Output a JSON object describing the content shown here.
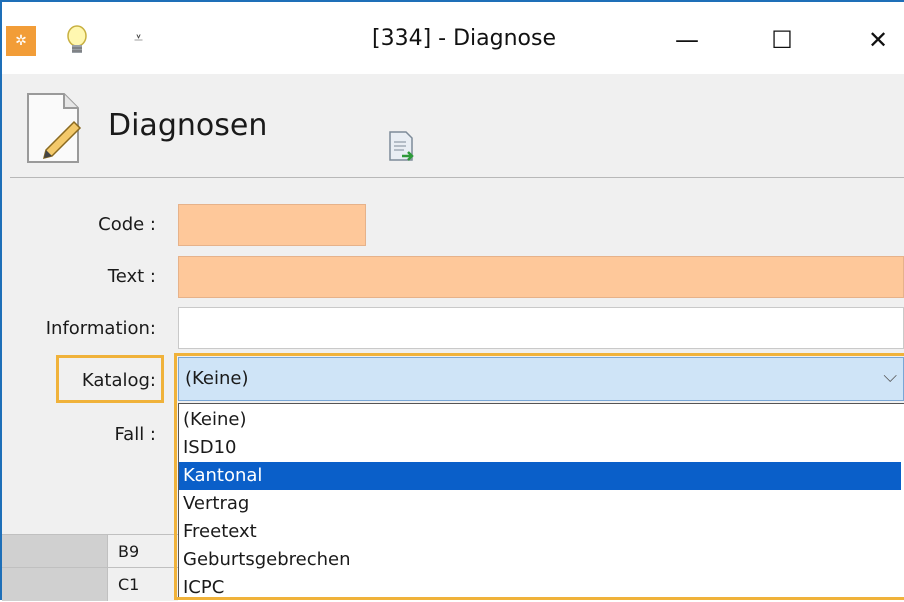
{
  "window": {
    "title": "[334] - Diagnose",
    "minimize_glyph": "—",
    "maximize_glyph": "☐",
    "close_glyph": "✕",
    "qa_arrow_glyph": "⩡"
  },
  "dialog": {
    "heading": "Diagnosen"
  },
  "form": {
    "code_label": "Code :",
    "text_label": "Text :",
    "information_label": "Information:",
    "katalog_label": "Katalog:",
    "fall_label": "Fall :",
    "katalog_selected": "(Keine)",
    "chevron_glyph": "⌵"
  },
  "dropdown": {
    "options": [
      "(Keine)",
      "ISD10",
      "Kantonal",
      "Vertrag",
      "Freetext",
      "Geburtsgebrechen",
      "ICPC"
    ],
    "highlighted": "Kantonal"
  },
  "background_grid": {
    "rows": [
      "B9",
      "C1"
    ]
  },
  "colors": {
    "required_field": "#fec89a",
    "select_bg": "#cfe4f7",
    "highlight_border": "#f0b23a",
    "selected_option_bg": "#0a5fc9",
    "window_border": "#1e6fb8"
  }
}
